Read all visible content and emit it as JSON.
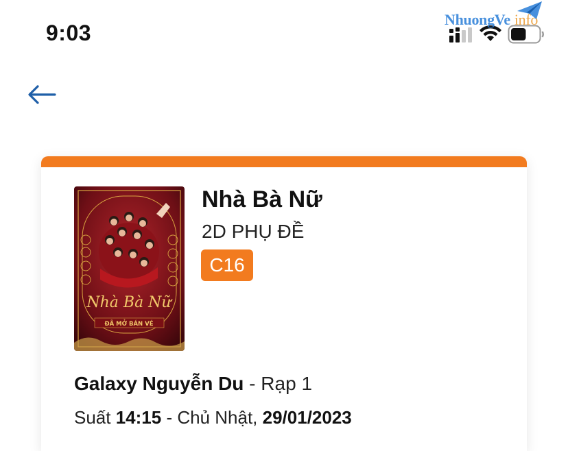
{
  "status_bar": {
    "time": "9:03",
    "signal_icon": "cellular-signal-icon",
    "wifi_icon": "wifi-icon",
    "battery_icon": "battery-icon",
    "battery_level": 0.55
  },
  "watermark": {
    "text": "NhuongVe",
    "suffix": "info",
    "icon": "paper-plane-icon"
  },
  "nav": {
    "back_icon": "arrow-left-icon"
  },
  "colors": {
    "accent": "#f27b1f",
    "back_arrow": "#1f5fa8"
  },
  "movie": {
    "title": "Nhà Bà Nữ",
    "format": "2D PHỤ ĐỀ",
    "age_rating": "C16",
    "poster": {
      "title_script": "Nhà Bà Nữ",
      "banner": "ĐÃ MỞ BÁN VÉ"
    }
  },
  "booking": {
    "cinema": "Galaxy Nguyễn Du",
    "separator": " - ",
    "room": "Rạp 1",
    "showtime_label": "Suất ",
    "time": "14:15",
    "day_sep": " - ",
    "day": "Chủ Nhật, ",
    "date": "29/01/2023"
  }
}
